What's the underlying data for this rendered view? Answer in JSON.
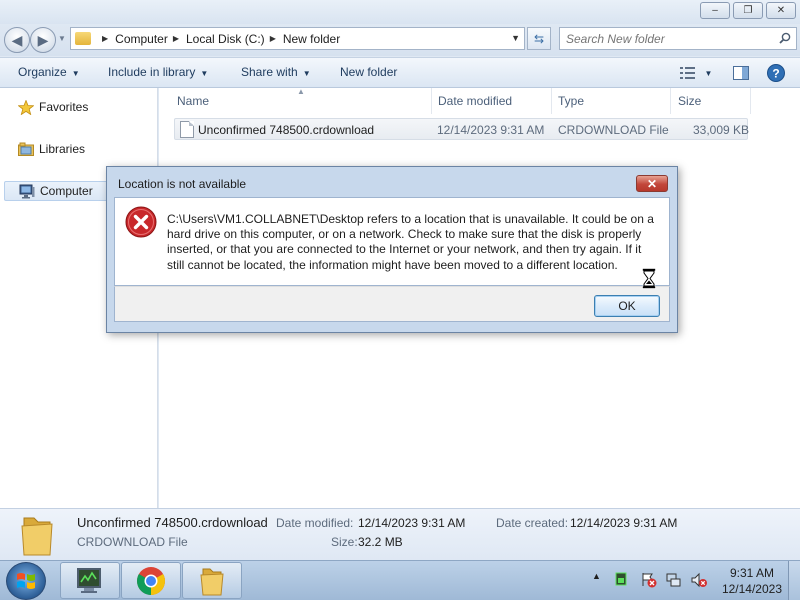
{
  "window": {
    "minimize_glyph": "–",
    "maximize_glyph": "❐",
    "close_glyph": "✕"
  },
  "address": {
    "breadcrumbs": [
      "Computer",
      "Local Disk (C:)",
      "New folder"
    ],
    "search_placeholder": "Search New folder"
  },
  "toolbar": {
    "organize": "Organize",
    "include_in_library": "Include in library",
    "share_with": "Share with",
    "new_folder": "New folder"
  },
  "nav": {
    "favorites": "Favorites",
    "libraries": "Libraries",
    "computer": "Computer"
  },
  "columns": {
    "name": "Name",
    "date_modified": "Date modified",
    "type": "Type",
    "size": "Size"
  },
  "files": [
    {
      "name": "Unconfirmed 748500.crdownload",
      "date_modified": "12/14/2023 9:31 AM",
      "type": "CRDOWNLOAD File",
      "size": "33,009 KB"
    }
  ],
  "details": {
    "name": "Unconfirmed 748500.crdownload",
    "type": "CRDOWNLOAD File",
    "date_modified_label": "Date modified:",
    "date_modified": "12/14/2023 9:31 AM",
    "size_label": "Size:",
    "size": "32.2 MB",
    "date_created_label": "Date created:",
    "date_created": "12/14/2023 9:31 AM"
  },
  "dialog": {
    "title": "Location is not available",
    "message": "C:\\Users\\VM1.COLLABNET\\Desktop refers to a location that is unavailable. It could be on a hard drive on this computer, or on a network. Check to make sure that the disk is properly inserted, or that you are connected to the Internet or your network, and then try again. If it still cannot be located, the information might have been moved to a different location.",
    "ok": "OK",
    "close_glyph": "✕"
  },
  "taskbar": {
    "time": "9:31 AM",
    "date": "12/14/2023"
  },
  "colors": {
    "dialog_close": "#c2463a",
    "error_red": "#c8282b",
    "folder_yellow": "#e8bd4a",
    "chrome_red": "#db4437",
    "chrome_yellow": "#f4c20d",
    "chrome_green": "#0f9d58",
    "chrome_blue": "#4285f4"
  }
}
